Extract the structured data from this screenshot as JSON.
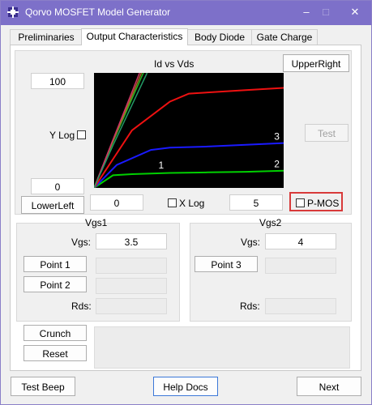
{
  "window": {
    "title": "Qorvo MOSFET Model Generator"
  },
  "tabs": [
    {
      "label": "Preliminaries"
    },
    {
      "label": "Output Characteristics"
    },
    {
      "label": "Body Diode"
    },
    {
      "label": "Gate Charge"
    }
  ],
  "chart": {
    "title": "Id vs Vds",
    "y_max": "100",
    "y_min": "0",
    "x_min": "0",
    "x_max": "5",
    "y_log_label": "Y Log",
    "x_log_label": "X Log",
    "curve_labels": [
      "1",
      "2",
      "3"
    ],
    "upper_right_label": "UpperRight",
    "lower_left_label": "LowerLeft",
    "test_label": "Test",
    "pmos_label": "P-MOS"
  },
  "chart_data": {
    "type": "line",
    "title": "Id vs Vds",
    "xlim": [
      0,
      5
    ],
    "ylim": [
      0,
      100
    ],
    "grid": false,
    "series": [
      {
        "color": "#00d000",
        "x": [
          0,
          0.5,
          1,
          2,
          3,
          4,
          5
        ],
        "y": [
          0,
          11,
          12,
          13,
          13.5,
          14,
          15
        ]
      },
      {
        "color": "#1a1aff",
        "x": [
          0,
          0.6,
          1.5,
          2,
          3,
          4,
          5
        ],
        "y": [
          0,
          20,
          33,
          35,
          36,
          37.5,
          39
        ]
      },
      {
        "color": "#ee1111",
        "x": [
          0,
          0.5,
          1,
          2,
          2.5,
          3,
          4,
          5
        ],
        "y": [
          0,
          25,
          50,
          75,
          82,
          83,
          85,
          87
        ]
      },
      {
        "color": "#22bb22",
        "x": [
          0,
          0.5,
          1.3
        ],
        "y": [
          0,
          40,
          100
        ]
      },
      {
        "color": "#aa6622",
        "x": [
          0,
          0.5,
          1.25
        ],
        "y": [
          0,
          41,
          100
        ]
      },
      {
        "color": "#cc3366",
        "x": [
          0,
          0.5,
          1.2
        ],
        "y": [
          0,
          42,
          100
        ]
      },
      {
        "color": "#229966",
        "x": [
          0,
          0.5,
          1.4
        ],
        "y": [
          0,
          37,
          100
        ]
      }
    ]
  },
  "vgs1": {
    "title": "Vgs1",
    "vgs_label": "Vgs:",
    "vgs_value": "3.5",
    "point1_label": "Point 1",
    "point2_label": "Point 2",
    "rds_label": "Rds:"
  },
  "vgs2": {
    "title": "Vgs2",
    "vgs_label": "Vgs:",
    "vgs_value": "4",
    "point3_label": "Point 3",
    "rds_label": "Rds:"
  },
  "actions": {
    "crunch_label": "Crunch",
    "reset_label": "Reset"
  },
  "footer": {
    "test_beep_label": "Test Beep",
    "help_docs_label": "Help Docs",
    "next_label": "Next"
  }
}
